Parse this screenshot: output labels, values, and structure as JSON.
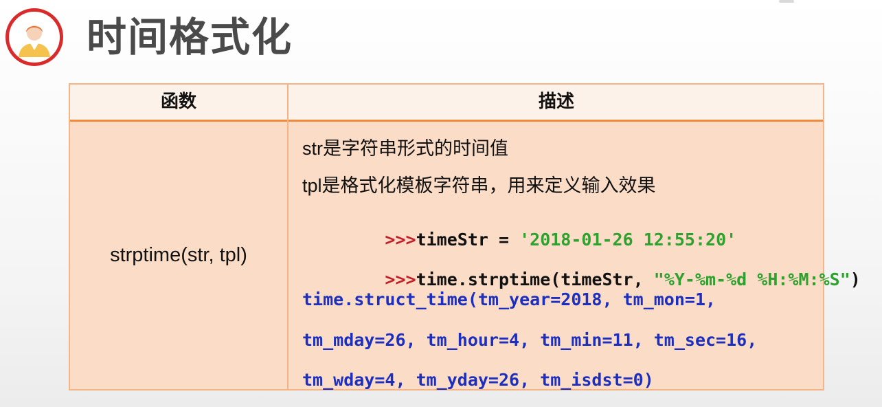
{
  "slide": {
    "title": "时间格式化",
    "avatar_icon": "user-avatar-icon",
    "accent_color": "#d92b2b"
  },
  "table": {
    "headers": [
      "函数",
      "描述"
    ],
    "row": {
      "function": "strptime(str, tpl)",
      "description_lines": [
        "str是字符串形式的时间值",
        "tpl是格式化模板字符串，用来定义输入效果"
      ],
      "code": {
        "line1_prompt": ">>>",
        "line1_code": "timeStr = ",
        "line1_string": "'2018-01-26 12:55:20'",
        "line2_prompt": ">>>",
        "line2_code": "time.strptime(timeStr, ",
        "line2_string": "\"%Y-%m-%d %H:%M:%S\"",
        "line2_close": ")",
        "output": [
          "time.struct_time(tm_year=2018, tm_mon=1,",
          "tm_mday=26, tm_hour=4, tm_min=11, tm_sec=16,",
          "tm_wday=4, tm_yday=26, tm_isdst=0)"
        ]
      }
    }
  }
}
